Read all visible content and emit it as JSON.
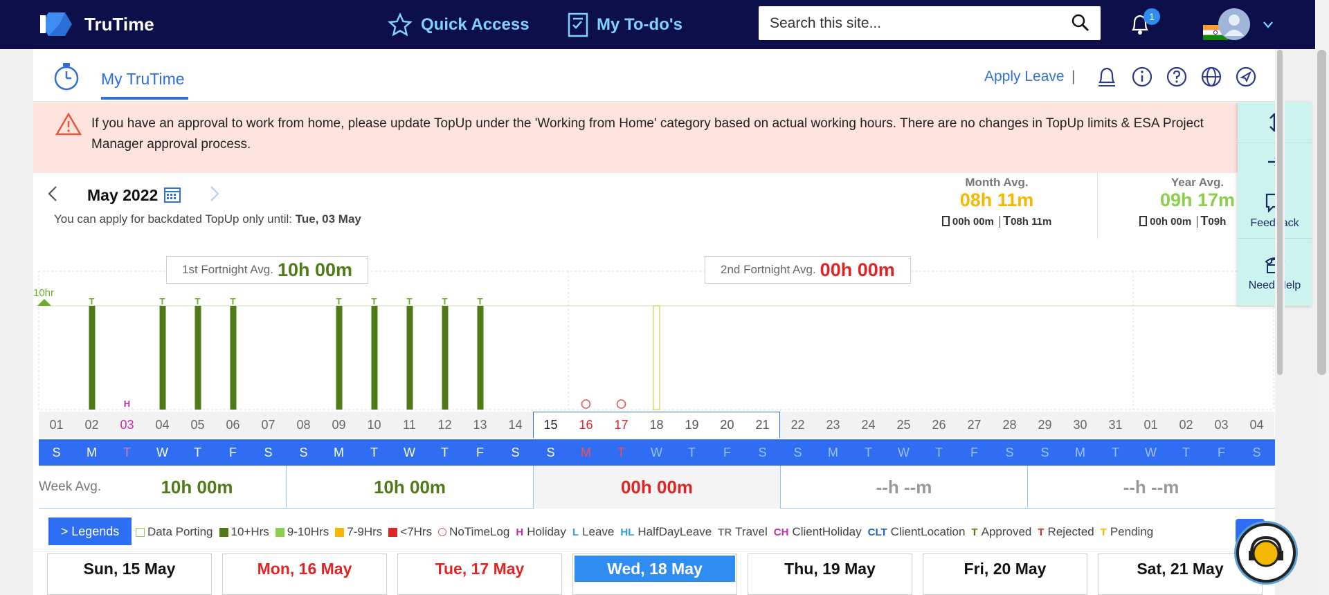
{
  "brand": "TruTime",
  "nav": {
    "quick_access": "Quick Access",
    "todos": "My To-do's"
  },
  "search": {
    "placeholder": "Search this site..."
  },
  "notifications": {
    "count": "1"
  },
  "page": {
    "tab": "My TruTime",
    "apply_leave": "Apply Leave",
    "separator": "|"
  },
  "notice": "If you have an approval to work from home, please update TopUp under the 'Working from Home' category based on actual working hours. There are no changes in TopUp limits & ESA Project Manager approval process.",
  "calendar": {
    "month": "May 2022",
    "backdated_text": "You can apply for backdated TopUp only until:",
    "backdated_date": "Tue, 03 May"
  },
  "month_avg": {
    "label": "Month Avg.",
    "value": "08h 11m",
    "a": "00h 00m",
    "t": "08h 11m"
  },
  "year_avg": {
    "label": "Year Avg.",
    "value": "09h 17m",
    "a": "00h 00m",
    "t": "09h"
  },
  "fortnight1": {
    "label": "1st Fortnight Avg.",
    "value": "10h 00m"
  },
  "fortnight2": {
    "label": "2nd Fortnight Avg.",
    "value": "00h 00m"
  },
  "chart_data": {
    "type": "bar",
    "threshold_label": "10hr",
    "categories": [
      "01",
      "02",
      "03",
      "04",
      "05",
      "06",
      "07",
      "08",
      "09",
      "10",
      "11",
      "12",
      "13",
      "14",
      "15",
      "16",
      "17",
      "18",
      "19",
      "20",
      "21",
      "22",
      "23",
      "24",
      "25",
      "26",
      "27",
      "28",
      "29",
      "30",
      "31",
      "01",
      "02",
      "03",
      "04"
    ],
    "values": [
      0,
      10,
      0,
      10,
      10,
      10,
      0,
      0,
      10,
      10,
      10,
      10,
      10,
      0,
      0,
      0,
      0,
      0,
      0,
      0,
      0,
      0,
      0,
      0,
      0,
      0,
      0,
      0,
      0,
      0,
      0,
      0,
      0,
      0,
      0
    ],
    "markers": [
      "",
      "T",
      "H",
      "T",
      "T",
      "T",
      "",
      "",
      "T",
      "T",
      "T",
      "T",
      "T",
      "",
      "",
      "NTL",
      "NTL",
      "",
      "",
      "",
      "",
      "",
      "",
      "",
      "",
      "",
      "",
      "",
      "",
      "",
      "",
      "",
      "",
      "",
      ""
    ],
    "weekdays": [
      "S",
      "M",
      "T",
      "W",
      "T",
      "F",
      "S",
      "S",
      "M",
      "T",
      "W",
      "T",
      "F",
      "S",
      "S",
      "M",
      "T",
      "W",
      "T",
      "F",
      "S",
      "S",
      "M",
      "T",
      "W",
      "T",
      "F",
      "S",
      "S",
      "M",
      "T",
      "W",
      "T",
      "F",
      "S"
    ]
  },
  "week_avg": {
    "label": "Week Avg.",
    "values": [
      "10h 00m",
      "10h 00m",
      "00h 00m",
      "--h --m",
      "--h --m"
    ]
  },
  "legends": {
    "button": "> Legends",
    "items": [
      "Data Porting",
      "10+Hrs",
      "9-10Hrs",
      "7-9Hrs",
      "<7Hrs",
      "NoTimeLog",
      "Holiday",
      "Leave",
      "HalfDayLeave",
      "Travel",
      "ClientHoliday",
      "ClientLocation",
      "Approved",
      "Rejected",
      "Pending"
    ],
    "codes": [
      "",
      "",
      "",
      "",
      "",
      "",
      "H",
      "L",
      "HL",
      "TR",
      "CH",
      "CLT",
      "T",
      "T",
      "T"
    ],
    "colors": [
      "#ffffff",
      "#4e7a17",
      "#8ccf4d",
      "#f5b800",
      "#e02424",
      "",
      "#c02fa6",
      "#2e9fd8",
      "#2e9fd8",
      "#777777",
      "#c02fa6",
      "#1565c0",
      "#4e7a17",
      "#e02424",
      "#f5b800"
    ]
  },
  "day_cards": [
    "Sun, 15 May",
    "Mon, 16 May",
    "Tue, 17 May",
    "Wed, 18 May",
    "Thu, 19 May",
    "Fri, 20 May",
    "Sat, 21 May"
  ],
  "side": {
    "feedback": "Feedback",
    "need_help": "Need Help"
  }
}
